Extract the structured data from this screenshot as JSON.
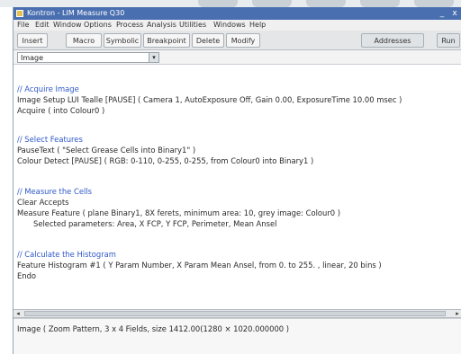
{
  "window": {
    "title": "Kontron - LIM Measure Q30",
    "minimize_glyph": "_",
    "close_glyph": "x"
  },
  "menu": [
    "File",
    "Edit",
    "Window",
    "Options",
    "Process",
    "Analysis",
    "Utilities",
    "Windows",
    "Help"
  ],
  "toolbar": {
    "buttons": [
      "Insert",
      "Macro",
      "Symbolic",
      "Breakpoint",
      "Delete",
      "Modify"
    ],
    "right_buttons": [
      "Addresses",
      "Run"
    ]
  },
  "selector": {
    "value": "Image",
    "arrow_glyph": "▾"
  },
  "code_lines": [
    {
      "kind": "comment",
      "text": "// Acquire Image"
    },
    {
      "kind": "code",
      "text": "Image Setup LUI Tealle  [PAUSE]  ( Camera 1,  AutoExposure Off,  Gain 0.00,  ExposureTime 10.00 msec )"
    },
    {
      "kind": "code",
      "text": "Acquire  ( into Colour0 )"
    },
    {
      "kind": "comment",
      "text": "// Select Features"
    },
    {
      "kind": "code",
      "text": "PauseText  ( \"Select Grease Cells into Binary1\" )"
    },
    {
      "kind": "code",
      "text": "Colour Detect  [PAUSE]  ( RGB: 0-110, 0-255, 0-255, from Colour0 into Binary1 )"
    },
    {
      "kind": "comment",
      "text": "// Measure the Cells"
    },
    {
      "kind": "code",
      "text": "Clear Accepts"
    },
    {
      "kind": "code",
      "text": "Measure Feature  ( plane Binary1, 8X ferets, minimum area: 10, grey image: Colour0 )"
    },
    {
      "kind": "code",
      "indent": true,
      "text": "Selected parameters:  Area, X FCP, Y FCP, Perimeter, Mean Ansel"
    },
    {
      "kind": "comment",
      "text": "// Calculate the Histogram"
    },
    {
      "kind": "code",
      "text": "Feature Histogram #1  ( Y Param Number,  X Param Mean Ansel, from 0. to 255. , linear, 20 bins )"
    },
    {
      "kind": "code",
      "text": "Endo"
    }
  ],
  "scrollbar": {
    "left_glyph": "◂",
    "right_glyph": "▸"
  },
  "output": {
    "text": "Image  ( Zoom Pattern, 3 x 4 Fields, size 1412.00(1280 × 1020.000000 )"
  }
}
